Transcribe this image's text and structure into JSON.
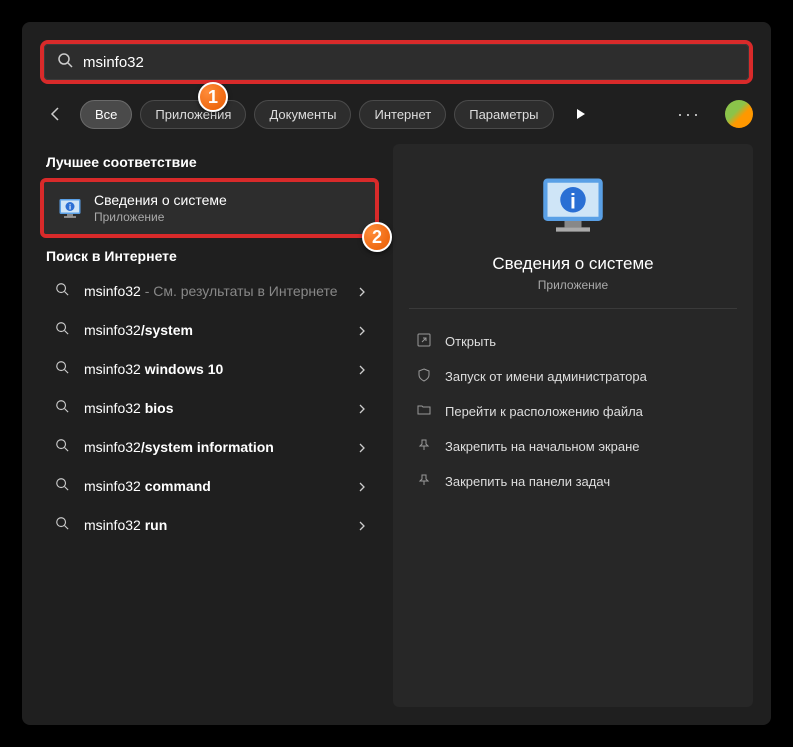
{
  "search": {
    "value": "msinfo32"
  },
  "filters": {
    "all": "Все",
    "apps": "Приложения",
    "docs": "Документы",
    "internet": "Интернет",
    "settings": "Параметры"
  },
  "sections": {
    "best_match": "Лучшее соответствие",
    "search_web": "Поиск в Интернете"
  },
  "best_match": {
    "title": "Сведения о системе",
    "subtitle": "Приложение"
  },
  "web": [
    {
      "pre": "msinfo32",
      "suf": " - См. результаты в Интернете",
      "gray_suf": true
    },
    {
      "pre": "msinfo32",
      "bold": "/system"
    },
    {
      "pre": "msinfo32 ",
      "bold": "windows 10"
    },
    {
      "pre": "msinfo32 ",
      "bold": "bios"
    },
    {
      "pre": "msinfo32",
      "bold": "/system information"
    },
    {
      "pre": "msinfo32 ",
      "bold": "command"
    },
    {
      "pre": "msinfo32 ",
      "bold": "run"
    }
  ],
  "preview": {
    "title": "Сведения о системе",
    "subtitle": "Приложение"
  },
  "actions": {
    "open": "Открыть",
    "run_admin": "Запуск от имени администратора",
    "open_location": "Перейти к расположению файла",
    "pin_start": "Закрепить на начальном экране",
    "pin_taskbar": "Закрепить на панели задач"
  },
  "annotations": {
    "badge1": "1",
    "badge2": "2"
  }
}
